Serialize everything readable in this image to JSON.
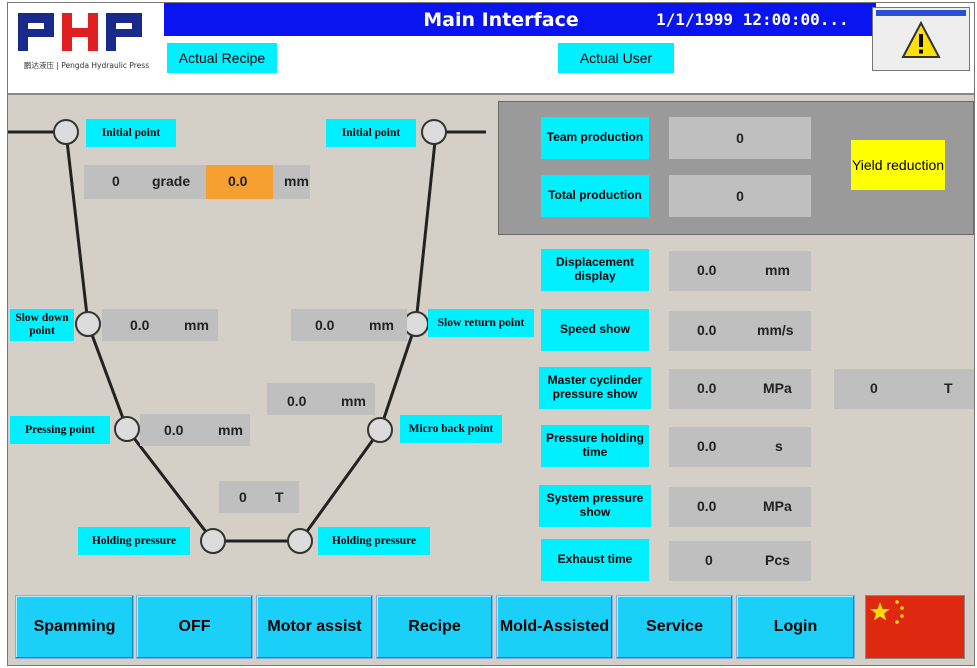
{
  "header": {
    "logo_text": "PHP",
    "logo_subtitle": "鹏达液压 | Pengda Hydraulic Press",
    "title": "Main Interface",
    "datetime": "1/1/1999 12:00:00...",
    "actual_recipe_label": "Actual Recipe",
    "actual_user_label": "Actual User",
    "warning_icon": "warning-icon"
  },
  "diagram": {
    "initial_point_left": "Initial point",
    "initial_point_right": "Initial point",
    "grade_value": "0",
    "grade_label": "grade",
    "grade_mm_value": "0.0",
    "grade_mm_unit": "mm",
    "slow_down_point": "Slow down point",
    "slow_down_value": "0.0",
    "slow_down_unit": "mm",
    "slow_return_point": "Slow return point",
    "slow_return_value": "0.0",
    "slow_return_unit": "mm",
    "micro_back_value": "0.0",
    "micro_back_unit": "mm",
    "pressing_point": "Pressing point",
    "pressing_value": "0.0",
    "pressing_unit": "mm",
    "micro_back_point": "Micro back point",
    "tonnage_value": "0",
    "tonnage_unit": "T",
    "holding_pressure_left": "Holding pressure",
    "holding_pressure_right": "Holding pressure"
  },
  "production": {
    "team_label": "Team production",
    "team_value": "0",
    "total_label": "Total production",
    "total_value": "0",
    "yield_button": "Yield reduction"
  },
  "readouts": [
    {
      "label": "Displacement display",
      "value": "0.0",
      "unit": "mm"
    },
    {
      "label": "Speed show",
      "value": "0.0",
      "unit": "mm/s"
    },
    {
      "label": "Master cyclinder pressure show",
      "value": "0.0",
      "unit": "MPa"
    },
    {
      "label": "Pressure holding time",
      "value": "0.0",
      "unit": "s"
    },
    {
      "label": "System pressure show",
      "value": "0.0",
      "unit": "MPa"
    },
    {
      "label": "Exhaust time",
      "value": "0",
      "unit": "Pcs"
    }
  ],
  "tonnage_extra": {
    "value": "0",
    "unit": "T"
  },
  "footer": {
    "buttons": [
      "Spamming",
      "OFF",
      "Motor assist",
      "Recipe",
      "Mold-Assisted",
      "Service",
      "Login"
    ],
    "flag": "china-flag-icon"
  },
  "colors": {
    "title_bar": "#0a14f0",
    "label_cyan": "#00f0ff",
    "button_cyan": "#1ad0f8",
    "highlight_orange": "#f5a030",
    "yield_yellow": "#ffff00",
    "flag_red": "#de2910"
  }
}
